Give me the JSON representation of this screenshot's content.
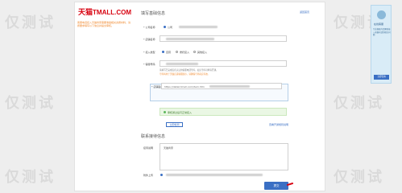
{
  "brand": {
    "logo_cn": "天猫",
    "logo_en": "TMALL.COM"
  },
  "header": {
    "top_link": "返回首页"
  },
  "notice": {
    "text": "客服电话接入天猫商家需要准备相关资质材料，请按要求填写以下信息并提交审核。"
  },
  "section1": {
    "title": "填写基础信息",
    "fields": {
      "company_label": "* 公司名称",
      "company_radio1": "公司",
      "shop_label": "* 店铺名称",
      "type_label": "* 接入类型",
      "type_opt1": "自营",
      "type_opt2": "委托接入",
      "type_opt3": "其他接入",
      "number_label": "* 客服号码",
      "number_note1": "请填写已完成实名认证的客服电话号码，如无号码可申请开通。",
      "number_note2": "号码将用于天猫店铺客服展示，请确保号码真实有效。",
      "link_label": "* 店铺链接",
      "link_value": "https://detail.tmall.com/item.htm"
    },
    "success_text": "审核通过后可正常接入",
    "check_button": "立即检测",
    "right_link": "查看开通规则说明"
  },
  "section2": {
    "title": "联系接待信息",
    "textarea_label": "接待说明",
    "textarea_value": "天猫商家",
    "bottom_label": "附件上传",
    "submit_label": "提交"
  },
  "float_panel": {
    "title": "在线客服",
    "body": "专业客服为您解答接入天猫电话的相关问题",
    "button": "立即咨询"
  },
  "watermark": {
    "text": "仅测试"
  }
}
